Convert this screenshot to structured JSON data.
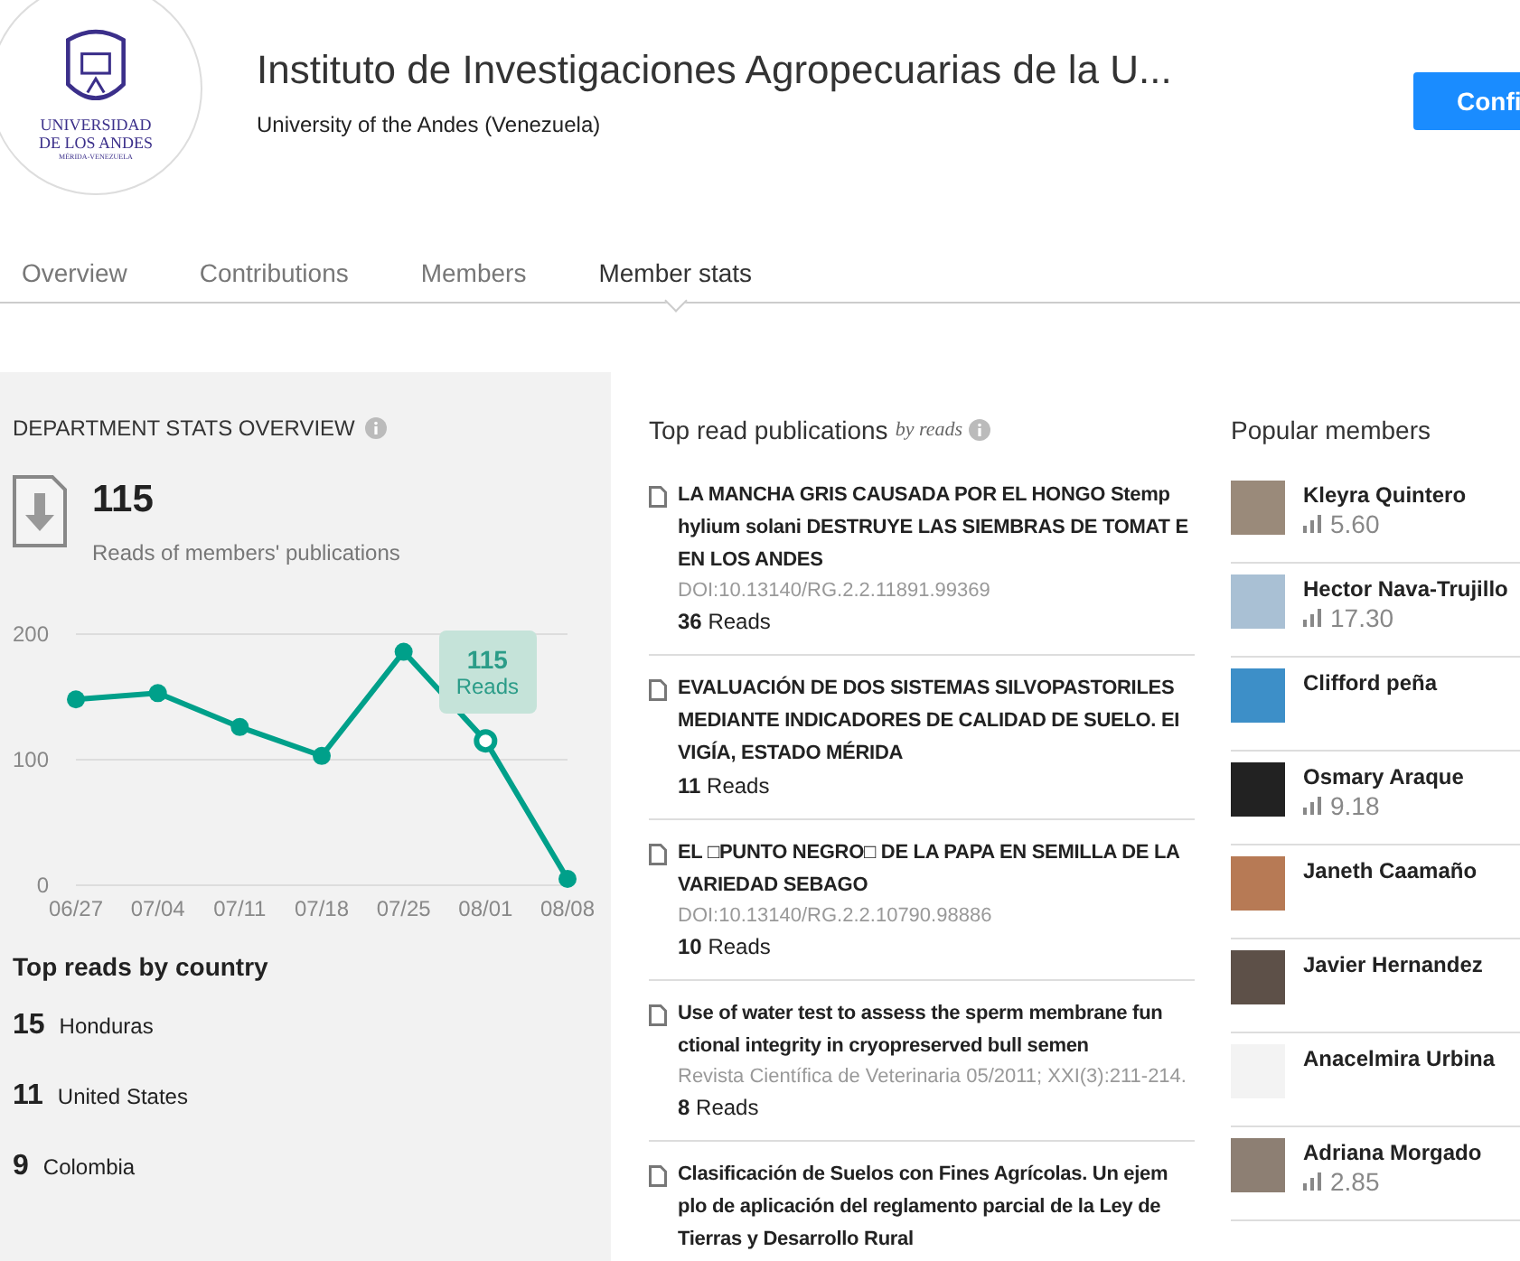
{
  "header": {
    "logo_text": [
      "UNIVERSIDAD",
      "DE LOS ANDES",
      "MÉRIDA-VENEZUELA"
    ],
    "title": "Instituto de Investigaciones Agropecuarias de la U...",
    "subtitle": "University of the Andes (Venezuela)",
    "button": "Confi"
  },
  "tabs": [
    {
      "label": "Overview",
      "selected": false
    },
    {
      "label": "Contributions",
      "selected": false
    },
    {
      "label": "Members",
      "selected": false
    },
    {
      "label": "Member stats",
      "selected": true
    }
  ],
  "overview": {
    "heading": "DEPARTMENT STATS OVERVIEW",
    "total": "115",
    "total_label": "Reads of members' publications",
    "chart_data": {
      "type": "line",
      "categories": [
        "06/27",
        "07/04",
        "07/11",
        "07/18",
        "07/25",
        "08/01",
        "08/08"
      ],
      "series": [
        {
          "name": "Reads",
          "color": "#00a08a",
          "marker": true,
          "values": [
            148,
            153,
            126,
            103,
            186,
            115,
            5
          ]
        }
      ],
      "ylim": [
        0,
        200
      ],
      "yticks": [
        0,
        100,
        200
      ],
      "annotations": [
        {
          "x": "08/01",
          "y": 115,
          "text": "115"
        }
      ]
    },
    "countries_heading": "Top reads by country",
    "countries": [
      {
        "count": "15",
        "name": "Honduras"
      },
      {
        "count": "11",
        "name": "United States"
      },
      {
        "count": "9",
        "name": "Colombia"
      }
    ]
  },
  "publications": {
    "heading": "Top read publications",
    "sort": "by reads",
    "items": [
      {
        "title": "LA MANCHA GRIS CAUSADA POR EL HONGO Stemp hylium solani DESTRUYE LAS SIEMBRAS DE TOMAT E EN LOS ANDES",
        "meta": "DOI:10.13140/RG.2.2.11891.99369",
        "reads": "**36** Reads"
      },
      {
        "title": "EVALUACIÓN DE DOS SISTEMAS SILVOPASTORILES MEDIANTE INDICADORES DE CALIDAD DE SUELO. EI VIGÍA, ESTADO MÉRIDA",
        "reads": "**11** Reads"
      },
      {
        "title": "EL □PUNTO NEGRO□ DE LA PAPA EN SEMILLA DE LA VARIEDAD SEBAGO",
        "meta": "DOI:10.13140/RG.2.2.10790.98886",
        "reads": "**10** Reads"
      },
      {
        "title": "Use of water test to assess the sperm membrane fun ctional integrity in cryopreserved bull semen",
        "meta": "Revista Científica de Veterinaria 05/2011; XXI(3):211-214.",
        "reads": "**8** Reads"
      },
      {
        "title": "Clasificación de Suelos con Fines Agrícolas. Un ejem plo de aplicación del reglamento parcial de la Ley de Tierras y Desarrollo Rural"
      }
    ]
  },
  "members": {
    "heading": "Popular members",
    "items": [
      {
        "name": "Kleyra Quintero",
        "score": "5.60"
      },
      {
        "name": "Hector Nava-Trujillo",
        "score": "17.30"
      },
      {
        "name": "Clifford peña"
      },
      {
        "name": "Osmary Araque",
        "score": "9.18"
      },
      {
        "name": "Janeth Caamaño"
      },
      {
        "name": "Javier Hernandez"
      },
      {
        "name": "Anacelmira Urbina"
      },
      {
        "name": "Adriana Morgado",
        "score": "2.85"
      }
    ]
  }
}
